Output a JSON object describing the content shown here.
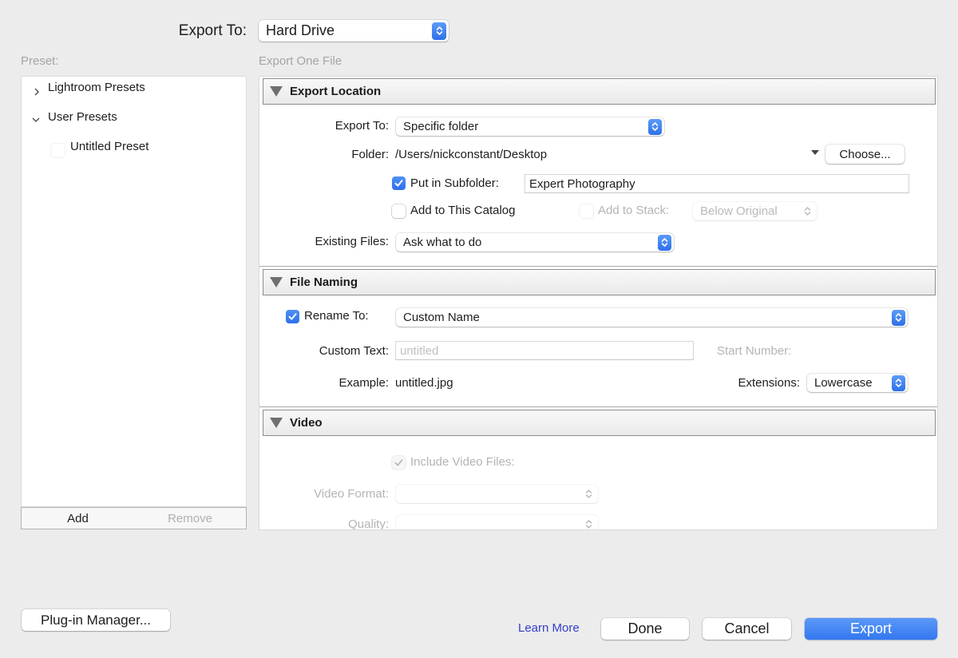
{
  "header": {
    "export_to_label": "Export To:",
    "export_to_value": "Hard Drive",
    "preset_label": "Preset:",
    "export_count_label": "Export One File"
  },
  "presets": {
    "groups": [
      {
        "label": "Lightroom Presets",
        "expanded": false
      },
      {
        "label": "User Presets",
        "expanded": true
      }
    ],
    "items": [
      {
        "label": "Untitled Preset",
        "checked": false
      }
    ],
    "add_label": "Add",
    "remove_label": "Remove"
  },
  "export_location": {
    "title": "Export Location",
    "export_to_label": "Export To:",
    "export_to_value": "Specific folder",
    "folder_label": "Folder:",
    "folder_value": "/Users/nickconstant/Desktop",
    "choose_label": "Choose...",
    "subfolder_label": "Put in Subfolder:",
    "subfolder_checked": true,
    "subfolder_value": "Expert Photography",
    "add_catalog_label": "Add to This Catalog",
    "add_catalog_checked": false,
    "add_stack_label": "Add to Stack:",
    "add_stack_checked": false,
    "stack_position_value": "Below Original",
    "existing_files_label": "Existing Files:",
    "existing_files_value": "Ask what to do"
  },
  "file_naming": {
    "title": "File Naming",
    "rename_label": "Rename To:",
    "rename_checked": true,
    "rename_value": "Custom Name",
    "custom_text_label": "Custom Text:",
    "custom_text_placeholder": "untitled",
    "start_number_label": "Start Number:",
    "example_label": "Example:",
    "example_value": "untitled.jpg",
    "extensions_label": "Extensions:",
    "extensions_value": "Lowercase"
  },
  "video": {
    "title": "Video",
    "include_label": "Include Video Files:",
    "include_checked": true,
    "format_label": "Video Format:",
    "format_value": "",
    "quality_label": "Quality:",
    "quality_value": ""
  },
  "footer": {
    "plugin_manager_label": "Plug-in Manager...",
    "learn_more_label": "Learn More",
    "done_label": "Done",
    "cancel_label": "Cancel",
    "export_label": "Export"
  },
  "colors": {
    "accent": "#3478f0",
    "link": "#2f3fc8",
    "background": "#ececec"
  }
}
